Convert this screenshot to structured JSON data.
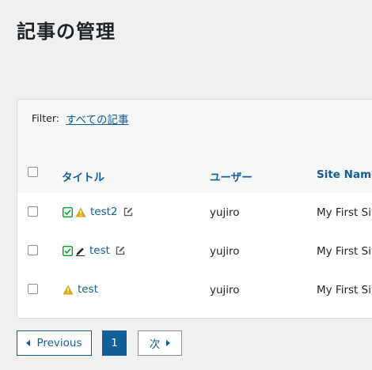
{
  "page": {
    "title": "記事の管理"
  },
  "filter": {
    "label": "Filter:",
    "link": "すべての記事"
  },
  "table": {
    "columns": {
      "title": "タイトル",
      "user": "ユーザー",
      "site": "Site Name"
    },
    "rows": [
      {
        "title": "test2",
        "user": "yujiro",
        "site": "My First Site"
      },
      {
        "title": "test",
        "user": "yujiro",
        "site": "My First Site"
      },
      {
        "title": "test",
        "user": "yujiro",
        "site": "My First Site"
      }
    ]
  },
  "pagination": {
    "previous": "Previous",
    "current": "1",
    "next": "次"
  },
  "colors": {
    "link": "#135e96",
    "warning": "#dba617",
    "approved": "#00a32a",
    "background": "#f0f0f1"
  }
}
